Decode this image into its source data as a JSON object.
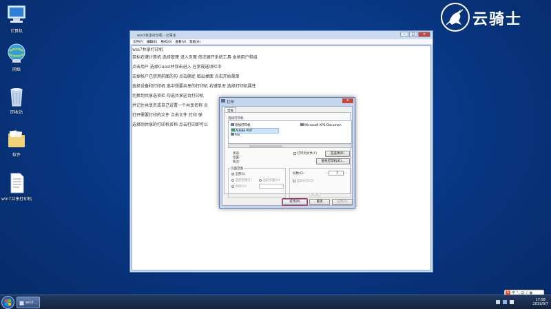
{
  "desktop": {
    "icons": [
      {
        "label": "计算机",
        "icon": "computer-icon"
      },
      {
        "label": "网络",
        "icon": "network-icon"
      },
      {
        "label": "回收站",
        "icon": "recycle-bin-icon"
      },
      {
        "label": "软件",
        "icon": "folder-icon"
      },
      {
        "label": "win7共享打印机",
        "icon": "text-file-icon"
      }
    ]
  },
  "brand": {
    "name": "云骑士"
  },
  "notepad": {
    "title": "win7共享打印机 - 记事本",
    "menu": [
      "文件(F)",
      "编辑(E)",
      "格式(O)",
      "查看(V)",
      "帮助(H)"
    ],
    "lines": [
      "win7共享打印机",
      "鼠标右键计算机    选择管理    进入页面    依次展开系统工具    本地用户和组",
      "点击用户    选择Guest并双击进入    在常规选项栏中",
      "去掉帐户已禁用前面的勾    点击确定    取出桌面    点击开始菜单",
      "选择设备和打印机    选中想要共享的打印机    右键单击    选择打印机属性",
      "切换到共享选项栏    勾选共享这台打印机",
      "并记住共享名或自己设置一个共享名称    点",
      "打开需要打印的文件    点击文件    打印    弹",
      "选择刚共享的打印机名称    点击打印即可以"
    ]
  },
  "print_dialog": {
    "title": "打印",
    "tab": "常规",
    "select_printer_label": "选择打印机",
    "printers": [
      {
        "name": "添加打印机",
        "icon": "add-printer-icon"
      },
      {
        "name": "Adobe PDF",
        "icon": "printer-icon"
      },
      {
        "name": "Fax",
        "icon": "fax-icon"
      },
      {
        "name": "Microsoft XPS Documen",
        "icon": "printer-icon"
      }
    ],
    "status_label": "状态:",
    "location_label": "位置:",
    "comment_label": "备注:",
    "print_to_file_label": "打印到文件(F)",
    "preferences_button": "首选项(R)",
    "find_printer_button": "查找打印机(D)...",
    "page_range_label": "页面范围",
    "range_all": "全部(L)",
    "range_selection": "选定范围(T)",
    "range_current": "当前页面(U)",
    "range_pages": "页码(G):",
    "copies_label": "份数(C):",
    "copies_value": "1",
    "collate_label": "自动分页(O)",
    "print_button": "打印(P)",
    "cancel_button": "取消",
    "apply_button": "应用(A)"
  },
  "taskbar": {
    "task_label": "win7...",
    "time": "17:58",
    "date": "2019/9/7"
  }
}
